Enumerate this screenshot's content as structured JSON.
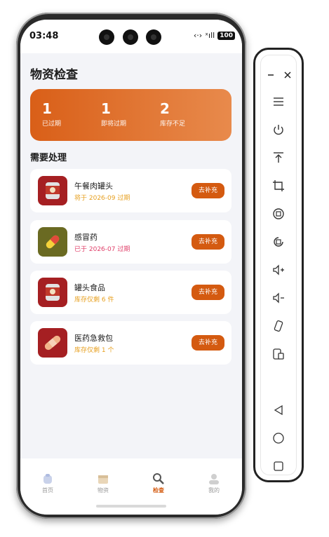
{
  "status": {
    "time": "03:48",
    "battery": "100"
  },
  "page": {
    "title": "物资检查"
  },
  "summary": [
    {
      "num": "1",
      "label": "已过期"
    },
    {
      "num": "1",
      "label": "即将过期"
    },
    {
      "num": "2",
      "label": "库存不足"
    }
  ],
  "section_title": "需要处理",
  "items": [
    {
      "name": "午餐肉罐头",
      "sub": "将于 2026-09 过期",
      "button": "去补充",
      "icon": "canned-food-icon",
      "sub_color": "#e7a020"
    },
    {
      "name": "感冒药",
      "sub": "已于 2026-07 过期",
      "button": "去补充",
      "icon": "pill-icon",
      "sub_color": "#e0406a"
    },
    {
      "name": "罐头食品",
      "sub": "库存仅剩 6 件",
      "button": "去补充",
      "icon": "canned-food-icon",
      "sub_color": "#e7a020"
    },
    {
      "name": "医药急救包",
      "sub": "库存仅剩 1 个",
      "button": "去补充",
      "icon": "bandage-icon",
      "sub_color": "#e7a020"
    }
  ],
  "tabs": [
    {
      "label": "首页",
      "icon": "home-icon",
      "active": false
    },
    {
      "label": "物资",
      "icon": "box-icon",
      "active": false
    },
    {
      "label": "检查",
      "icon": "magnifier-icon",
      "active": true
    },
    {
      "label": "我的",
      "icon": "user-icon",
      "active": false
    }
  ],
  "colors": {
    "accent": "#d45a10",
    "banner_start": "#d95f18",
    "banner_end": "#e88a4c",
    "warning": "#e7a020",
    "danger": "#e0406a"
  }
}
